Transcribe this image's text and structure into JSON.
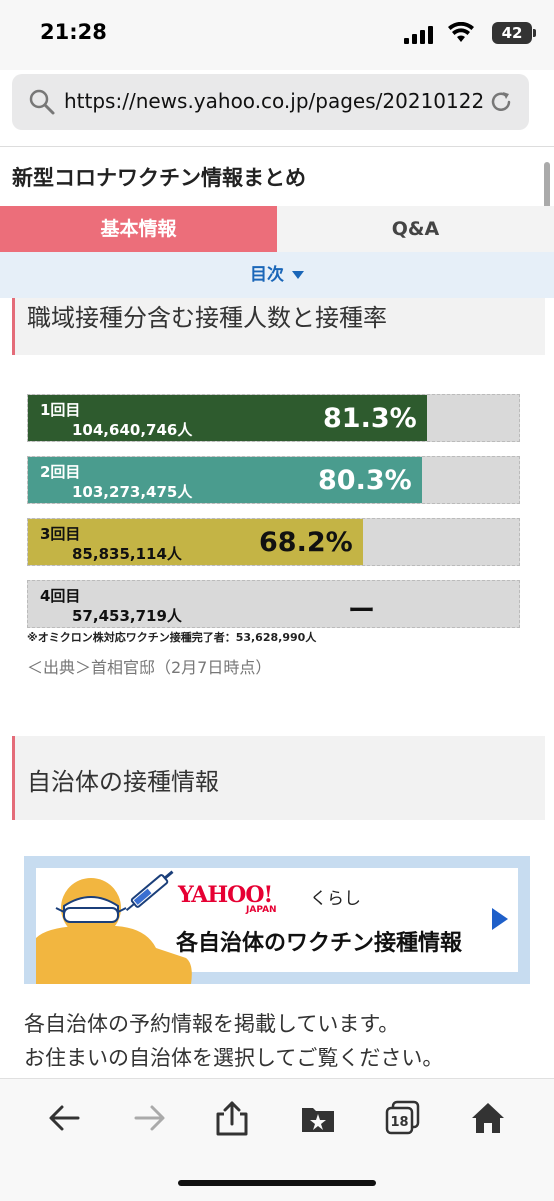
{
  "status_bar": {
    "time": "21:28",
    "battery": "42"
  },
  "browser": {
    "url": "https://news.yahoo.co.jp/pages/20210122"
  },
  "page": {
    "title": "新型コロナワクチン情報まとめ",
    "tabs": [
      {
        "label": "基本情報",
        "active": true
      },
      {
        "label": "Q&A",
        "active": false
      }
    ],
    "toc_label": "目次"
  },
  "section1": {
    "heading": "職域接種分含む接種人数と接種率"
  },
  "doses": [
    {
      "label": "1回目",
      "count": "104,640,746人",
      "pct_text": "81.3%",
      "fill_pct": 81.3,
      "color": "#2e5b2e",
      "text_color": "#ffffff"
    },
    {
      "label": "2回目",
      "count": "103,273,475人",
      "pct_text": "80.3%",
      "fill_pct": 80.3,
      "color": "#4a9c8e",
      "text_color": "#ffffff"
    },
    {
      "label": "3回目",
      "count": "85,835,114人",
      "pct_text": "68.2%",
      "fill_pct": 68.2,
      "color": "#c4b445",
      "text_color": "#111111"
    },
    {
      "label": "4回目",
      "count": "57,453,719人",
      "pct_text": "ー",
      "fill_pct": 0,
      "color": "#d9d9d9",
      "text_color": "#111111"
    }
  ],
  "note": "※オミクロン株対応ワクチン接種完了者：53,628,990人",
  "source": "＜出典＞首相官邸（2月7日時点）",
  "section2": {
    "heading": "自治体の接種情報"
  },
  "banner": {
    "logo": "YAHOO!",
    "logo_sub": "JAPAN",
    "service": "くらし",
    "title": "各自治体のワクチン接種情報"
  },
  "body_text": [
    "各自治体の予約情報を掲載しています。",
    "お住まいの自治体を選択してご覧ください。"
  ],
  "toolbar": {
    "tabs_count": "18",
    "icons": [
      "back-arrow-icon",
      "forward-arrow-icon",
      "share-icon",
      "bookmarks-icon",
      "tabs-icon",
      "home-icon"
    ]
  },
  "colors": {
    "accent": "#ec6e7a",
    "link_blue": "#1a66b8",
    "banner_bg": "#c7dcf0"
  }
}
